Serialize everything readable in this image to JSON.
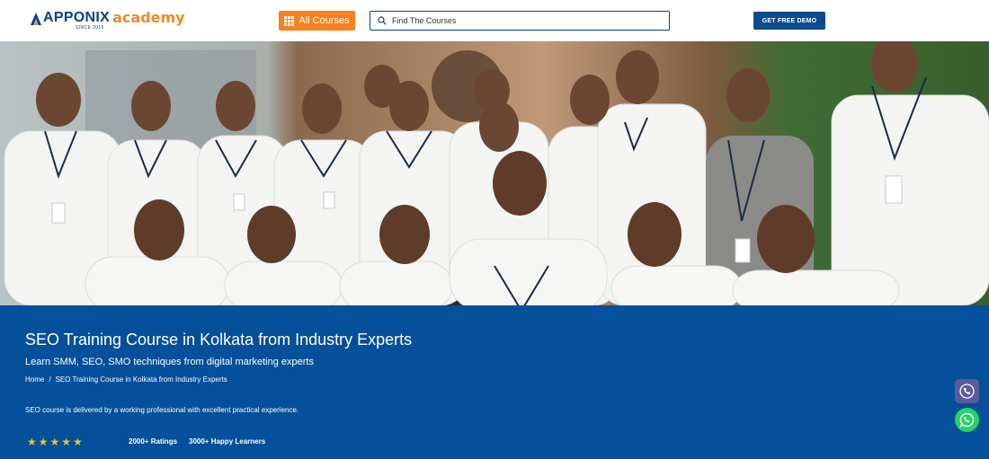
{
  "header": {
    "logo_brand": "APPONIX",
    "logo_since": "SINCE 2015",
    "logo_academy": "academy",
    "all_courses_label": "All Courses",
    "search_placeholder": "Find The Courses",
    "demo_label": "GET FREE DEMO"
  },
  "hero": {
    "image_alt": "Apponix team photo"
  },
  "banner": {
    "title": "SEO Training Course in Kolkata from Industry Experts",
    "subtitle": "Learn SMM, SEO, SMO techniques from digital marketing experts",
    "breadcrumb": {
      "home": "Home",
      "separator": "/",
      "current": "SEO Training Course in Kolkata from Industry Experts"
    },
    "description": "SEO course is delivered by a working professional with excellent practical experience.",
    "stars": [
      "★",
      "★",
      "★",
      "★",
      "★"
    ],
    "ratings": "2000+ Ratings",
    "learners": "3000+ Happy Learners"
  },
  "colors": {
    "brand_blue": "#04509a",
    "accent_orange": "#f7811e",
    "star_yellow": "#f7c21e",
    "whatsapp_green": "#25d366",
    "call_purple": "#5c5a99"
  },
  "icons": {
    "grid": "grid-icon",
    "search": "search-icon",
    "star": "star-icon",
    "phone": "phone-icon",
    "whatsapp": "whatsapp-icon"
  }
}
